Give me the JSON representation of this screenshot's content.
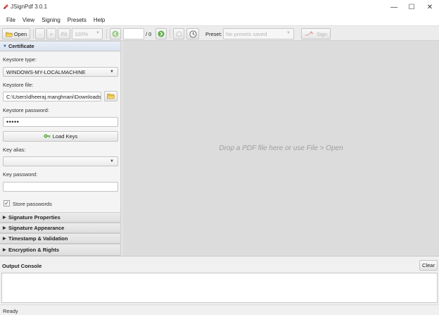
{
  "window": {
    "title": "JSignPdf 3.0.1",
    "minimize_glyph": "—",
    "maximize_glyph": "☐",
    "close_glyph": "✕"
  },
  "menu": [
    "File",
    "View",
    "Signing",
    "Presets",
    "Help"
  ],
  "toolbar": {
    "open_label": "Open",
    "zoom_out_label": "-",
    "zoom_in_label": "+",
    "fit_label": "Fit",
    "zoom_value": "100%",
    "page_input_value": "",
    "page_total": "/ 0",
    "preset_label": "Preset:",
    "preset_placeholder": "No presets saved",
    "sign_label": "Sign"
  },
  "sections": {
    "certificate": "Certificate",
    "signature_properties": "Signature Properties",
    "signature_appearance": "Signature Appearance",
    "timestamp_validation": "Timestamp & Validation",
    "encryption_rights": "Encryption & Rights"
  },
  "certificate": {
    "keystore_type_label": "Keystore type:",
    "keystore_type_value": "WINDOWS-MY-LOCALMACHINE",
    "keystore_file_label": "Keystore file:",
    "keystore_file_value": "C:\\Users\\dheeraj.manghnani\\Downloads",
    "keystore_password_label": "Keystore password:",
    "keystore_password_value": "•••••",
    "load_keys_label": "Load Keys",
    "key_alias_label": "Key alias:",
    "key_alias_value": "",
    "key_password_label": "Key password:",
    "key_password_value": "",
    "store_passwords_label": "Store passwords",
    "store_passwords_checked": "✓"
  },
  "main": {
    "drop_hint": "Drop a PDF file here or use File > Open"
  },
  "console": {
    "title": "Output Console",
    "clear_label": "Clear",
    "content": ""
  },
  "status": {
    "text": "Ready"
  },
  "icons": {
    "app": "pen-icon",
    "open": "folder-open-icon",
    "prev_page": "arrow-left-icon",
    "next_page": "arrow-right-icon",
    "history": "clock-icon",
    "sign": "signature-pen-icon",
    "browse": "folder-icon",
    "load_keys": "keys-icon"
  },
  "colors": {
    "accent_green": "#5fae4a",
    "folder_yellow": "#e9c24a",
    "section_open": "#dbe4f0"
  }
}
